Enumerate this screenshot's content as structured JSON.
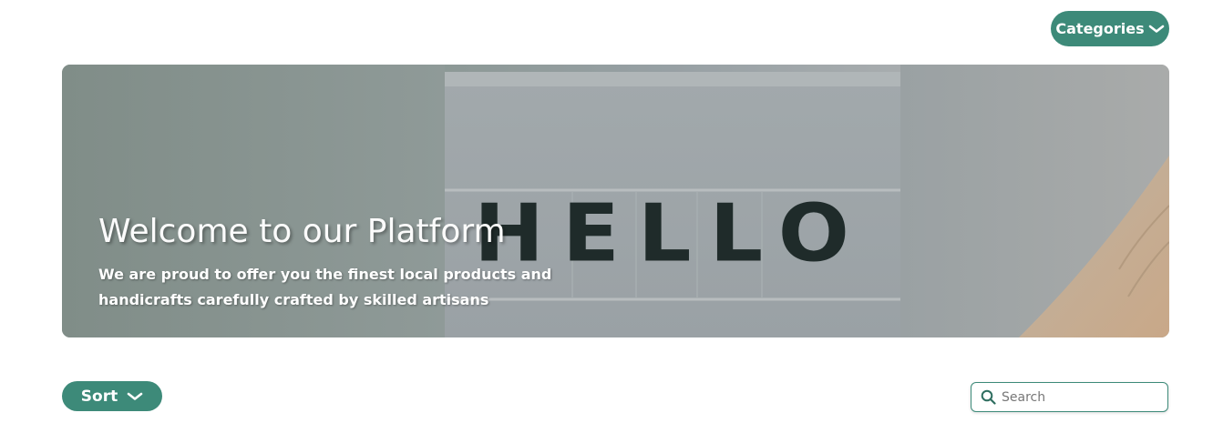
{
  "header": {
    "categories_label": "Categories",
    "categories_icon": "chevron-down-icon"
  },
  "hero": {
    "title": "Welcome to our Platform",
    "subtitle": "We are proud to offer you the finest local products and handicrafts carefully crafted by skilled artisans",
    "image_text": "HELLO",
    "image_letters": [
      "H",
      "E",
      "L",
      "L",
      "O"
    ],
    "image_description": "lightbox-sign"
  },
  "toolbar": {
    "sort_label": "Sort",
    "sort_icon": "chevron-down-icon",
    "search_placeholder": "Search",
    "search_value": "",
    "search_icon": "search-icon"
  },
  "colors": {
    "accent": "#3d8a79",
    "background": "#ffffff",
    "hero_text": "#ffffff"
  }
}
